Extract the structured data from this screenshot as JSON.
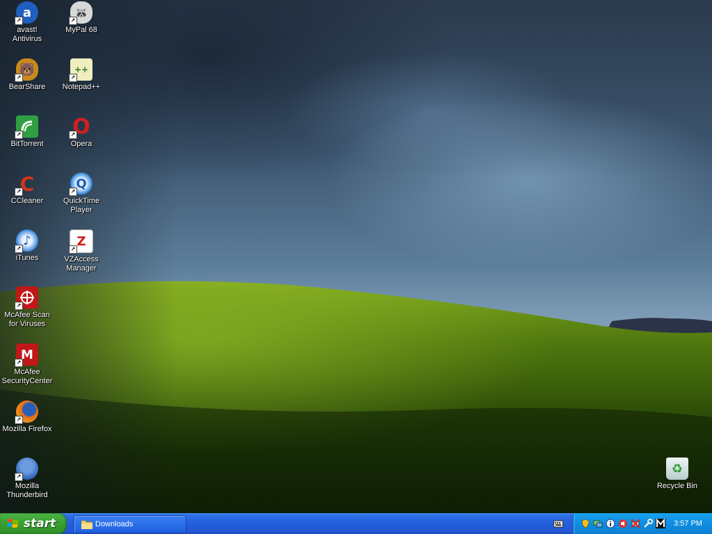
{
  "desktop": {
    "icons": [
      {
        "label": "avast!\nAntivirus",
        "color": "#1f5fbf",
        "glyph": "a"
      },
      {
        "label": "MyPal 68",
        "color": "#444444",
        "glyph": ""
      },
      {
        "label": "BearShare",
        "color": "#c98a1a",
        "glyph": ""
      },
      {
        "label": "Notepad++",
        "color": "#e8e8b0",
        "glyph": ""
      },
      {
        "label": "BitTorrent",
        "color": "#2ea043",
        "glyph": ""
      },
      {
        "label": "Opera",
        "color": "#d21f1f",
        "glyph": "O"
      },
      {
        "label": "CCleaner",
        "color": "#c43a1a",
        "glyph": "C"
      },
      {
        "label": "QuickTime\nPlayer",
        "color": "#2a7fd4",
        "glyph": "Q"
      },
      {
        "label": "iTunes",
        "color": "#3a86d8",
        "glyph": "♪"
      },
      {
        "label": "VZAccess\nManager",
        "color": "#ffffff",
        "glyph": "Z"
      },
      {
        "label": "McAfee Scan\nfor Viruses",
        "color": "#c01818",
        "glyph": ""
      },
      {
        "label": "McAfee\nSecurityCenter",
        "color": "#c01818",
        "glyph": "M"
      },
      {
        "label": "Mozilla Firefox",
        "color": "#e06b1a",
        "glyph": ""
      },
      {
        "label": "Mozilla\nThunderbird",
        "color": "#2d5fb0",
        "glyph": ""
      },
      {
        "label": "Recycle Bin",
        "color": "#d8e8e8",
        "glyph": "♻"
      }
    ]
  },
  "taskbar": {
    "start_label": "start",
    "task_label": "Downloads",
    "clock": "3:57 PM"
  },
  "tray_icons": [
    "shield-icon",
    "network-icon",
    "info-icon",
    "volume-icon",
    "disconnected-icon",
    "tools-icon",
    "mcafee-icon"
  ]
}
